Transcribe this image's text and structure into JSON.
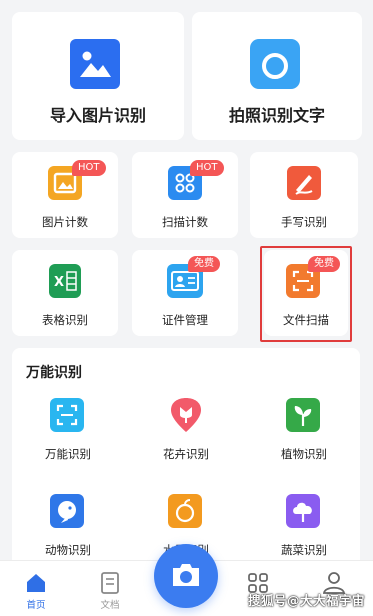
{
  "top_cards": [
    {
      "label": "导入图片识别",
      "icon": "image-icon"
    },
    {
      "label": "拍照识别文字",
      "icon": "camera-icon"
    }
  ],
  "tools_row1": [
    {
      "label": "图片计数",
      "badge": "HOT",
      "icon": "image-count-icon"
    },
    {
      "label": "扫描计数",
      "badge": "HOT",
      "icon": "scan-count-icon"
    },
    {
      "label": "手写识别",
      "icon": "handwriting-icon"
    }
  ],
  "tools_row2": [
    {
      "label": "表格识别",
      "icon": "excel-icon"
    },
    {
      "label": "证件管理",
      "badge": "免费",
      "icon": "id-card-icon"
    },
    {
      "label": "文件扫描",
      "badge": "免费",
      "icon": "document-scan-icon"
    }
  ],
  "universal": {
    "title": "万能识别",
    "items": [
      {
        "label": "万能识别",
        "icon": "universal-scan-icon"
      },
      {
        "label": "花卉识别",
        "icon": "flower-icon"
      },
      {
        "label": "植物识别",
        "icon": "plant-icon"
      },
      {
        "label": "动物识别",
        "icon": "animal-icon"
      },
      {
        "label": "水果识别",
        "icon": "fruit-icon"
      },
      {
        "label": "蔬菜识别",
        "icon": "vegetable-icon"
      }
    ]
  },
  "tabbar": {
    "tabs": [
      {
        "label": "首页",
        "icon": "home-icon",
        "active": true
      },
      {
        "label": "文档",
        "icon": "document-icon"
      },
      {
        "label": "",
        "icon": "apps-icon"
      },
      {
        "label": "",
        "icon": "profile-icon"
      }
    ],
    "camera_icon": "camera-icon"
  },
  "watermark": "搜狐号@大大福宇宙",
  "colors": {
    "accent": "#3b7cf0",
    "badge": "#f45656",
    "highlight": "#e03c3c"
  }
}
